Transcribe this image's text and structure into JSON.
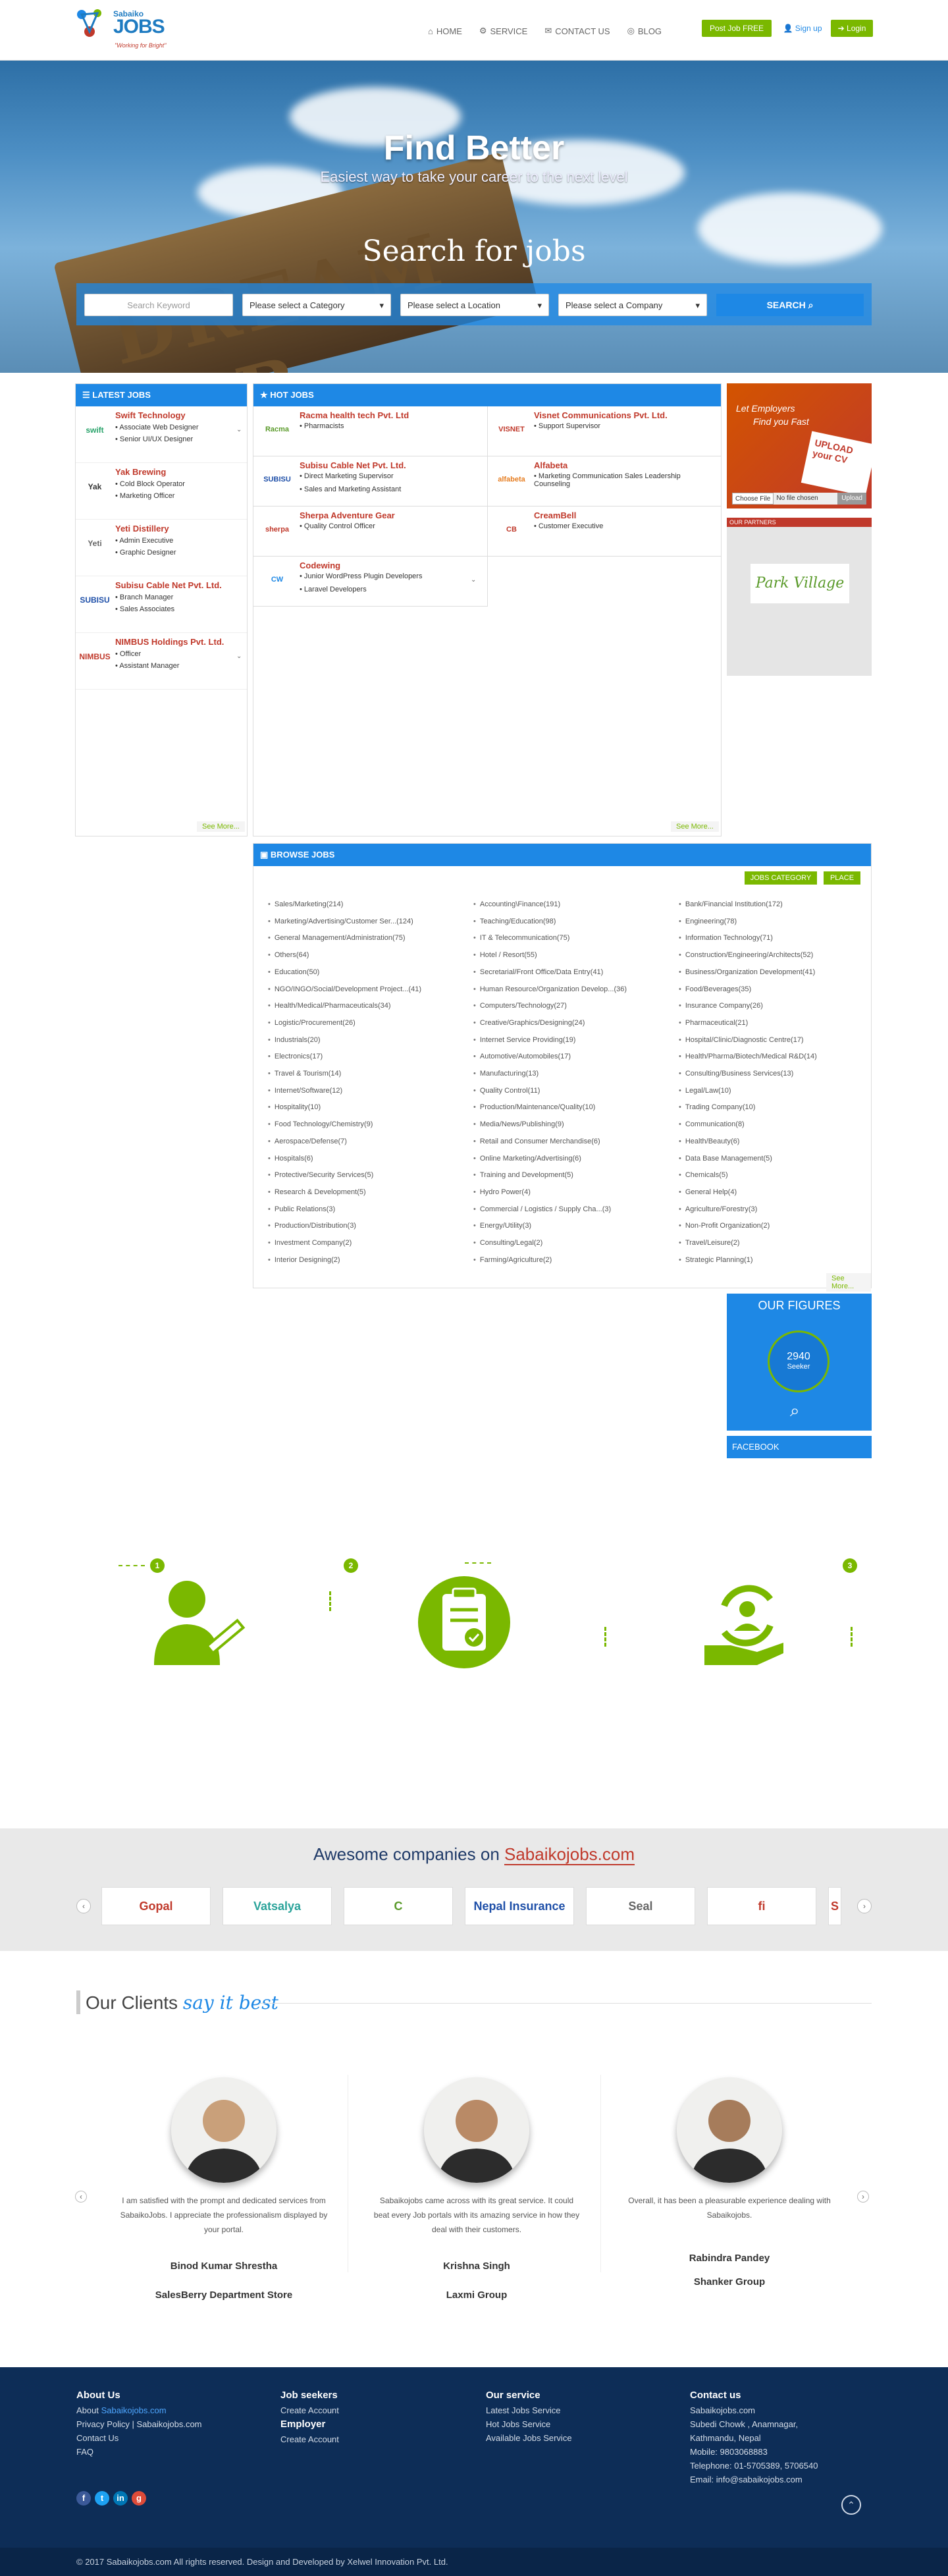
{
  "header": {
    "logo_small": "Sabaiko",
    "logo_big": "JOBS",
    "logo_tagline": "\"Working for Bright\"",
    "nav": [
      "HOME",
      "SERVICE",
      "CONTACT US",
      "BLOG"
    ],
    "post_job": "Post Job FREE",
    "signup": "Sign up",
    "login": "Login"
  },
  "hero": {
    "title": "Find Better",
    "subtitle": "Easiest way to take your career to the next level",
    "board_text": "DREAM JOB",
    "search_title": "Search for jobs",
    "keyword_placeholder": "Search Keyword",
    "category_select": "Please select a Category",
    "location_select": "Please select a Location",
    "company_select": "Please select a Company",
    "search_btn": "SEARCH"
  },
  "latest_jobs": {
    "title": "LATEST JOBS",
    "see_more": "See More...",
    "items": [
      {
        "company": "Swift Technology",
        "logo": "swift",
        "positions": [
          "Associate Web Designer",
          "Senior UI/UX Designer"
        ]
      },
      {
        "company": "Yak Brewing",
        "logo": "Yak",
        "positions": [
          "Cold Block Operator",
          "Marketing Officer"
        ]
      },
      {
        "company": "Yeti Distillery",
        "logo": "Yeti",
        "positions": [
          "Admin Executive",
          "Graphic Designer"
        ]
      },
      {
        "company": "Subisu Cable Net Pvt. Ltd.",
        "logo": "SUBISU",
        "positions": [
          "Branch Manager",
          "Sales Associates"
        ]
      },
      {
        "company": "NIMBUS Holdings Pvt. Ltd.",
        "logo": "NIMBUS",
        "positions": [
          "Officer",
          "Assistant Manager"
        ]
      }
    ]
  },
  "hot_jobs": {
    "title": "HOT JOBS",
    "see_more": "See More...",
    "items": [
      {
        "company": "Racma health tech Pvt. Ltd",
        "logo": "Racma",
        "positions": [
          "Pharmacists"
        ]
      },
      {
        "company": "Visnet Communications Pvt. Ltd.",
        "logo": "VISNET",
        "positions": [
          "Support Supervisor"
        ]
      },
      {
        "company": "Subisu Cable Net Pvt. Ltd.",
        "logo": "SUBISU",
        "positions": [
          "Direct Marketing Supervisor",
          "Sales and Marketing Assistant"
        ]
      },
      {
        "company": "Alfabeta",
        "logo": "alfabeta",
        "positions": [
          "Marketing Communication Sales Leadership Counseling"
        ]
      },
      {
        "company": "Sherpa Adventure Gear",
        "logo": "sherpa",
        "positions": [
          "Quality Control Officer"
        ]
      },
      {
        "company": "CreamBell",
        "logo": "CB",
        "positions": [
          "Customer Executive"
        ]
      },
      {
        "company": "Codewing",
        "logo": "CW",
        "positions": [
          "Junior WordPress Plugin Developers",
          "Laravel Developers"
        ]
      }
    ]
  },
  "sidebar": {
    "ad_line1": "Let Employers",
    "ad_line2": "Find you Fast",
    "ad_upload": "UPLOAD your CV",
    "choose_file": "Choose File",
    "no_file": "No file chosen",
    "upload": "Upload",
    "partners_title": "OUR PARTNERS",
    "partner_name": "Park Village",
    "figures_title": "OUR FIGURES",
    "seeker_count": "2940",
    "seeker_label": "Seeker",
    "facebook_title": "FACEBOOK"
  },
  "browse": {
    "title": "BROWSE JOBS",
    "tab_category": "JOBS CATEGORY",
    "tab_place": "PLACE",
    "see_more": "See More...",
    "col1": [
      "Sales/Marketing(214)",
      "Marketing/Advertising/Customer Ser...(124)",
      "General Management/Administration(75)",
      "Others(64)",
      "Education(50)",
      "NGO/INGO/Social/Development Project...(41)",
      "Health/Medical/Pharmaceuticals(34)",
      "Logistic/Procurement(26)",
      "Industrials(20)",
      "Electronics(17)",
      "Travel & Tourism(14)",
      "Internet/Software(12)",
      "Hospitality(10)",
      "Food Technology/Chemistry(9)",
      "Aerospace/Defense(7)",
      "Hospitals(6)",
      "Protective/Security Services(5)",
      "Research & Development(5)",
      "Public Relations(3)",
      "Production/Distribution(3)",
      "Investment Company(2)",
      "Interior Designing(2)"
    ],
    "col2": [
      "Accounting\\Finance(191)",
      "Teaching/Education(98)",
      "IT & Telecommunication(75)",
      "Hotel / Resort(55)",
      "Secretarial/Front Office/Data Entry(41)",
      "Human Resource/Organization Develop...(36)",
      "Computers/Technology(27)",
      "Creative/Graphics/Designing(24)",
      "Internet Service Providing(19)",
      "Automotive/Automobiles(17)",
      "Manufacturing(13)",
      "Quality Control(11)",
      "Production/Maintenance/Quality(10)",
      "Media/News/Publishing(9)",
      "Retail and Consumer Merchandise(6)",
      "Online Marketing/Advertising(6)",
      "Training and Development(5)",
      "Hydro Power(4)",
      "Commercial / Logistics / Supply Cha...(3)",
      "Energy/Utility(3)",
      "Consulting/Legal(2)",
      "Farming/Agriculture(2)"
    ],
    "col3": [
      "Bank/Financial Institution(172)",
      "Engineering(78)",
      "Information Technology(71)",
      "Construction/Engineering/Architects(52)",
      "Business/Organization Development(41)",
      "Food/Beverages(35)",
      "Insurance Company(26)",
      "Pharmaceutical(21)",
      "Hospital/Clinic/Diagnostic Centre(17)",
      "Health/Pharma/Biotech/Medical R&D(14)",
      "Consulting/Business Services(13)",
      "Legal/Law(10)",
      "Trading Company(10)",
      "Communication(8)",
      "Health/Beauty(6)",
      "Data Base Management(5)",
      "Chemicals(5)",
      "General Help(4)",
      "Agriculture/Forestry(3)",
      "Non-Profit Organization(2)",
      "Travel/Leisure(2)",
      "Strategic Planning(1)"
    ]
  },
  "steps": [
    "1",
    "2",
    "3"
  ],
  "companies": {
    "title_prefix": "Awesome companies on ",
    "title_link": "Sabaikojobs.com",
    "logos": [
      "Gopal",
      "Vatsalya",
      "C",
      "Nepal Insurance",
      "Seal",
      "fi",
      "S"
    ]
  },
  "clients": {
    "title": "Our Clients",
    "title_script": "say it best",
    "items": [
      {
        "text": "I am satisfied with the prompt and dedicated services from SabaikoJobs. I appreciate the professionalism displayed by your portal.",
        "name": "Binod Kumar Shrestha",
        "org": "SalesBerry Department Store"
      },
      {
        "text": "Sabaikojobs came across with its great service. It could beat every Job portals with its amazing service in how they deal with their customers.",
        "name": "Krishna Singh",
        "org": "Laxmi Group"
      },
      {
        "text": "Overall, it has been a pleasurable experience dealing with Sabaikojobs.",
        "name": "Rabindra Pandey",
        "org": "Shanker Group"
      }
    ]
  },
  "footer": {
    "about_title": "About Us",
    "about_prefix": "About ",
    "about_link": "Sabaikojobs.com",
    "privacy": "Privacy Policy | Sabaikojobs.com",
    "contact": "Contact Us",
    "faq": "FAQ",
    "seekers_title": "Job seekers",
    "create_account": "Create Account",
    "employer_title": "Employer",
    "employer_create": "Create Account",
    "service_title": "Our service",
    "service1": "Latest Jobs Service",
    "service2": "Hot Jobs Service",
    "service3": "Available Jobs Service",
    "contact_title": "Contact us",
    "c1": "Sabaikojobs.com",
    "c2": "Subedi Chowk , Anamnagar,",
    "c3": "Kathmandu, Nepal",
    "c4": "Mobile: 9803068883",
    "c5": "Telephone: 01-5705389, 5706540",
    "c6": "Email: info@sabaikojobs.com",
    "copyright": "© 2017 Sabaikojobs.com All rights reserved. Design and Developed by Xelwel Innovation Pvt. Ltd."
  }
}
